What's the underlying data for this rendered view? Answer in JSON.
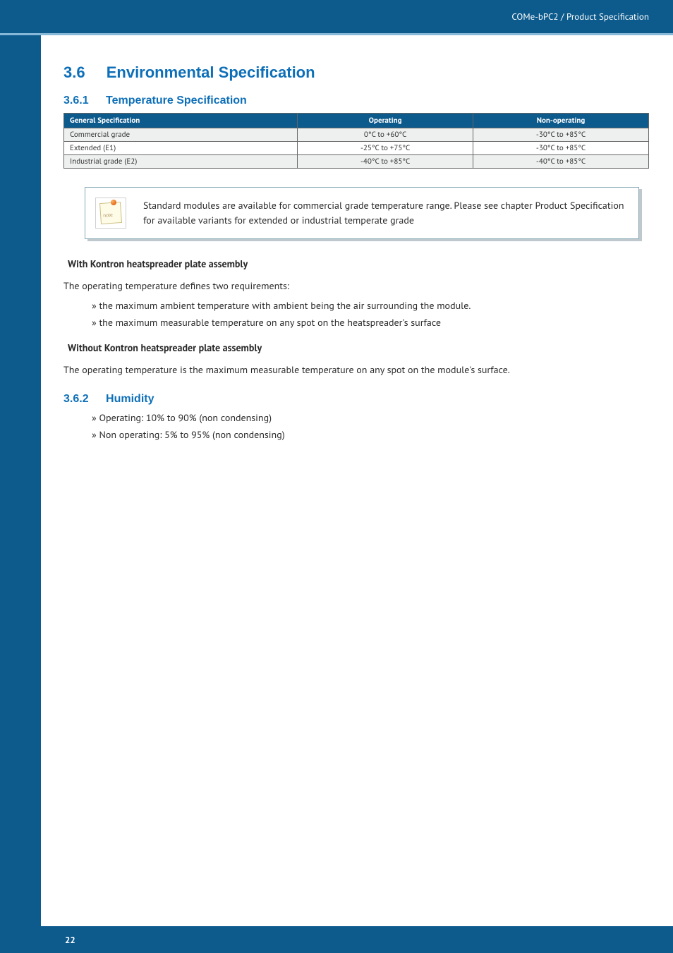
{
  "header": {
    "breadcrumb": "COMe-bPC2 / Product Specification"
  },
  "section": {
    "number": "3.6",
    "title": "Environmental Specification"
  },
  "sub1": {
    "number": "3.6.1",
    "title": "Temperature Specification",
    "table": {
      "headers": [
        "General Specification",
        "Operating",
        "Non-operating"
      ],
      "rows": [
        {
          "label": "Commercial grade",
          "operating": "0°C to +60°C",
          "nonoperating": "-30°C to +85°C"
        },
        {
          "label": "Extended (E1)",
          "operating": "-25°C to +75°C",
          "nonoperating": "-30°C to +85°C"
        },
        {
          "label": "Industrial grade (E2)",
          "operating": "-40°C to +85°C",
          "nonoperating": "-40°C to +85°C"
        }
      ]
    }
  },
  "note": {
    "text": "Standard modules are available for commercial grade temperature range. Please see chapter Product Specification for available variants for extended or industrial temperate grade"
  },
  "with_hs": {
    "title": "With Kontron heatspreader plate assembly",
    "intro": "The operating temperature defines two requirements:",
    "items": [
      "the maximum ambient temperature with ambient being the air surrounding the module.",
      "the maximum measurable temperature on any spot on the heatspreader's surface"
    ]
  },
  "without_hs": {
    "title": "Without Kontron heatspreader plate assembly",
    "text": "The operating temperature is the maximum measurable temperature on any spot on the module's surface."
  },
  "sub2": {
    "number": "3.6.2",
    "title": "Humidity",
    "items": [
      "Operating: 10% to 90% (non condensing)",
      "Non operating: 5% to 95% (non condensing)"
    ]
  },
  "footer": {
    "page": "22"
  }
}
